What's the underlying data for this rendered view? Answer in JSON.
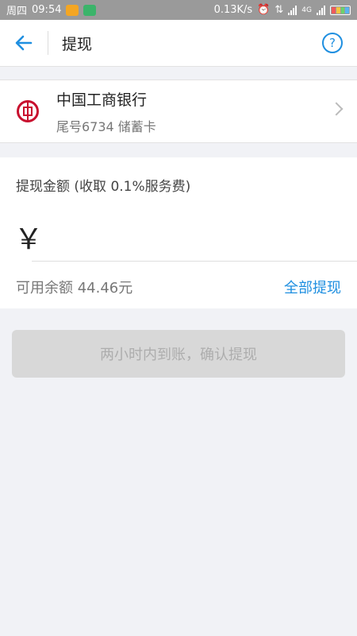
{
  "status_bar": {
    "day": "周四",
    "time": "09:54",
    "network_speed": "0.13K/s",
    "net_type": "4G"
  },
  "header": {
    "back_icon": "arrow-left-icon",
    "title": "提现",
    "help_icon": "question-circle-icon",
    "help_symbol": "?"
  },
  "bank": {
    "name": "中国工商银行",
    "detail": "尾号6734 储蓄卡",
    "logo_icon": "icbc-logo-icon",
    "chevron_icon": "chevron-right-icon"
  },
  "amount": {
    "label": "提现金额 (收取 0.1%服务费)",
    "currency_symbol": "￥",
    "input_value": "",
    "balance_text": "可用余额 44.46元",
    "withdraw_all_label": "全部提现"
  },
  "confirm": {
    "label": "两小时内到账，确认提现"
  },
  "colors": {
    "accent": "#1f8fe0",
    "bank_red": "#c8102e",
    "disabled_button": "#d8d8d8"
  }
}
